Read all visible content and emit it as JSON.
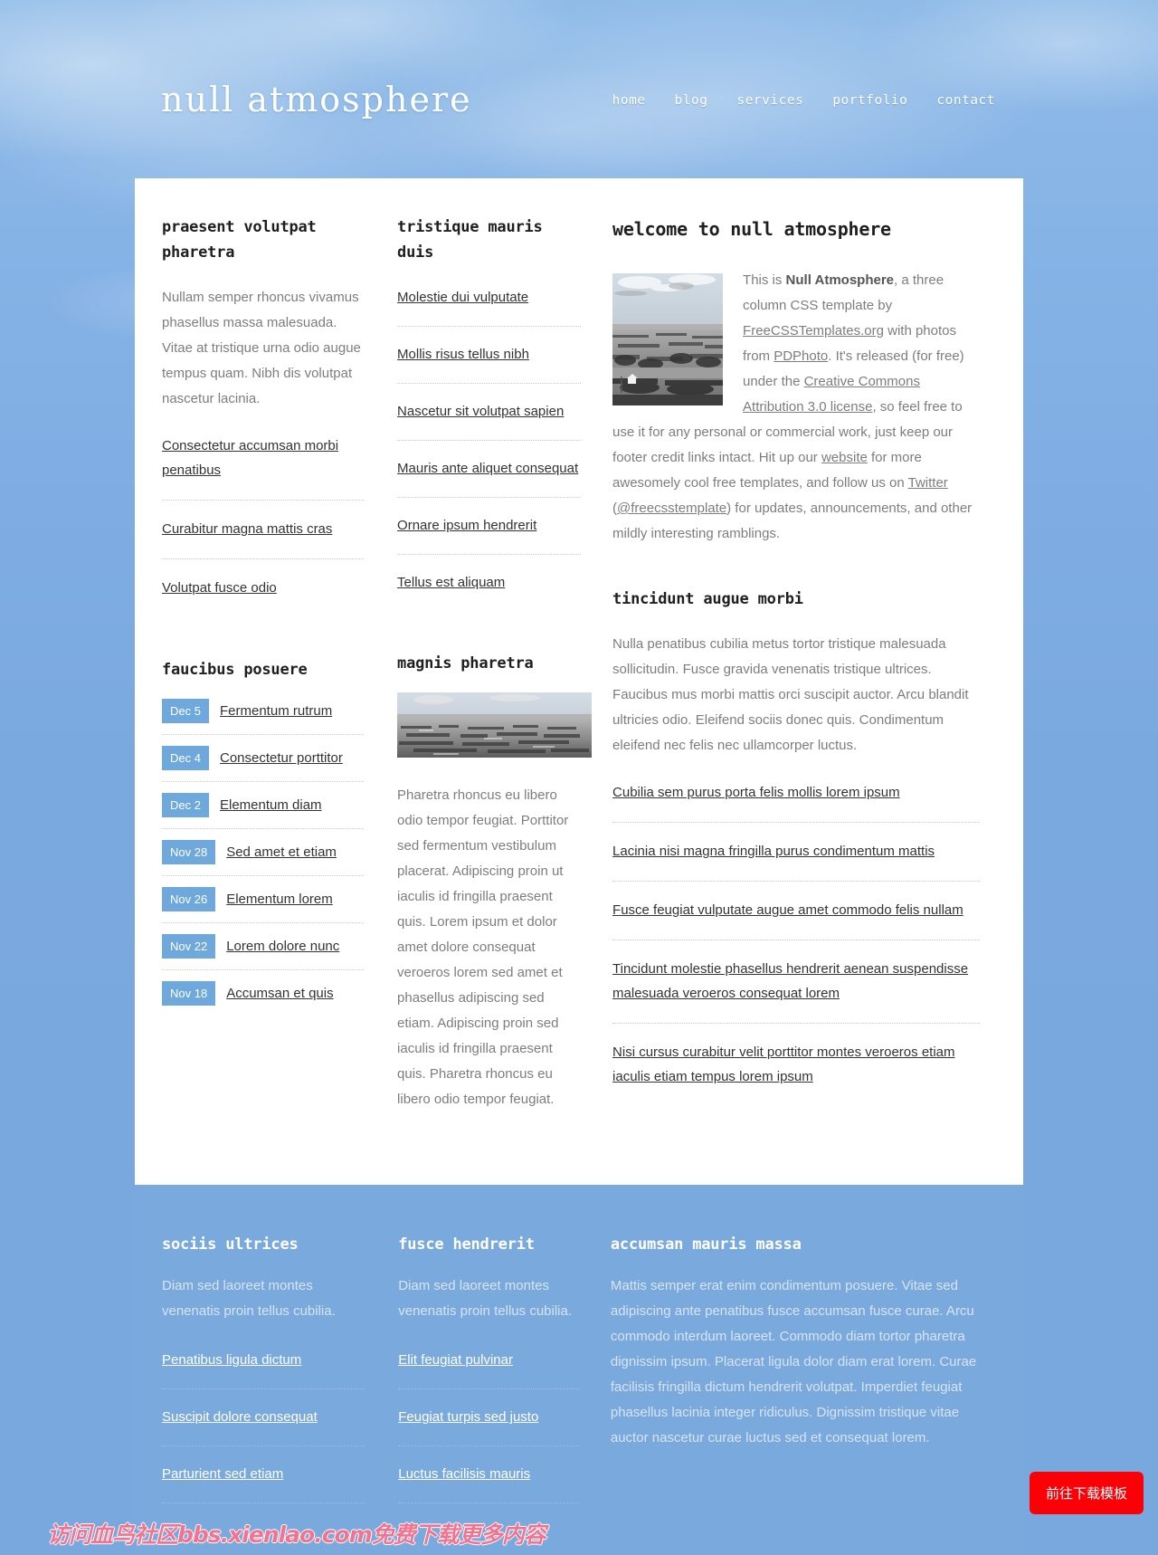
{
  "header": {
    "logo": "null atmosphere",
    "nav": [
      {
        "label": "home"
      },
      {
        "label": "blog"
      },
      {
        "label": "services"
      },
      {
        "label": "portfolio"
      },
      {
        "label": "contact"
      }
    ]
  },
  "left_column": {
    "title": "praesent volutpat pharetra",
    "paragraph": "Nullam semper rhoncus vivamus phasellus massa malesuada. Vitae at tristique urna odio augue tempus quam. Nibh dis volutpat nascetur lacinia.",
    "links": [
      {
        "label": "Consectetur accumsan morbi penatibus"
      },
      {
        "label": "Curabitur magna mattis cras"
      },
      {
        "label": "Volutpat fusce odio"
      }
    ],
    "news_title": "faucibus posuere",
    "news": [
      {
        "date": "Dec 5",
        "label": "Fermentum rutrum"
      },
      {
        "date": "Dec 4",
        "label": "Consectetur porttitor"
      },
      {
        "date": "Dec 2",
        "label": "Elementum diam"
      },
      {
        "date": "Nov 28",
        "label": "Sed amet et etiam"
      },
      {
        "date": "Nov 26",
        "label": "Elementum lorem"
      },
      {
        "date": "Nov 22",
        "label": "Lorem dolore nunc"
      },
      {
        "date": "Nov 18",
        "label": "Accumsan et quis"
      }
    ]
  },
  "mid_column": {
    "title": "tristique mauris duis",
    "links": [
      {
        "label": "Molestie dui vulputate"
      },
      {
        "label": "Mollis risus tellus nibh"
      },
      {
        "label": "Nascetur sit volutpat sapien"
      },
      {
        "label": "Mauris ante aliquet consequat"
      },
      {
        "label": "Ornare ipsum hendrerit"
      },
      {
        "label": "Tellus est aliquam"
      }
    ],
    "second_title": "magnis pharetra",
    "image_name": "seascape-horizon-photo",
    "paragraph": "Pharetra rhoncus eu libero odio tempor feugiat. Porttitor sed fermentum vestibulum placerat. Adipiscing proin ut iaculis id fringilla praesent quis. Lorem ipsum et dolor amet dolore consequat veroeros lorem sed amet et phasellus adipiscing sed etiam. Adipiscing proin sed iaculis id fringilla praesent quis. Pharetra rhoncus eu libero odio tempor feugiat."
  },
  "main_column": {
    "title": "welcome to null atmosphere",
    "image_name": "countryside-landscape-photo",
    "intro": {
      "t1": "This is ",
      "brand": "Null Atmosphere",
      "t2": ", a three column CSS template by ",
      "link1": "FreeCSSTemplates.org",
      "t3": " with photos from ",
      "link2": "PDPhoto",
      "t4": ". It's released (for free) under the ",
      "link3": "Creative Commons Attribution 3.0 license",
      "t5": ", so feel free to use it for any personal or commercial work, just keep our footer credit links intact. Hit up our ",
      "link4": "website",
      "t6": " for more awesomely cool free templates, and follow us on ",
      "link5": "Twitter",
      "t7": " (",
      "link6": "@freecsstemplate",
      "t8": ") for updates, announcements, and other mildly interesting ramblings."
    },
    "second_title": "tincidunt augue morbi",
    "paragraph": "Nulla penatibus cubilia metus tortor tristique malesuada sollicitudin. Fusce gravida venenatis tristique ultrices. Faucibus mus morbi mattis orci suscipit auctor. Arcu blandit ultricies odio. Eleifend sociis donec quis. Condimentum eleifend nec felis nec ullamcorper luctus.",
    "links": [
      {
        "label": "Cubilia sem purus porta felis mollis lorem ipsum"
      },
      {
        "label": "Lacinia nisi magna fringilla purus condimentum mattis"
      },
      {
        "label": "Fusce feugiat vulputate augue amet commodo felis nullam"
      },
      {
        "label": "Tincidunt molestie phasellus hendrerit aenean suspendisse malesuada veroeros consequat lorem"
      },
      {
        "label": "Nisi cursus curabitur velit porttitor montes veroeros etiam iaculis etiam tempus lorem ipsum"
      }
    ]
  },
  "footer": {
    "col1": {
      "title": "sociis ultrices",
      "paragraph": "Diam sed laoreet montes venenatis proin tellus cubilia.",
      "links": [
        {
          "label": "Penatibus ligula dictum"
        },
        {
          "label": "Suscipit dolore consequat"
        },
        {
          "label": "Parturient sed etiam"
        }
      ]
    },
    "col2": {
      "title": "fusce hendrerit",
      "paragraph": "Diam sed laoreet montes venenatis proin tellus cubilia.",
      "links": [
        {
          "label": "Elit feugiat pulvinar"
        },
        {
          "label": "Feugiat turpis sed justo"
        },
        {
          "label": "Luctus facilisis mauris"
        }
      ]
    },
    "col3": {
      "title": "accumsan mauris massa",
      "paragraph": "Mattis semper erat enim condimentum posuere. Vitae sed adipiscing ante penatibus fusce accumsan fusce curae. Arcu commodo interdum laoreet. Commodo diam tortor pharetra dignissim ipsum. Placerat ligula dolor diam erat lorem. Curae facilisis fringilla dictum hendrerit volutpat. Imperdiet feugiat phasellus lacinia integer ridiculus. Dignissim tristique vitae auctor nascetur curae luctus sed et consequat lorem."
    }
  },
  "overlay": {
    "watermark": "访问血鸟社区bbs.xienlao.com免费下载更多内容",
    "download_button": "前往下载模板"
  },
  "colors": {
    "sky_blue": "#7aa9de",
    "badge_blue": "#6fa8dc",
    "panel_white": "#ffffff",
    "body_gray": "#7d7d7d",
    "link_dark": "#333333",
    "button_red": "#fb0007",
    "watermark_pink": "#f2738f"
  }
}
